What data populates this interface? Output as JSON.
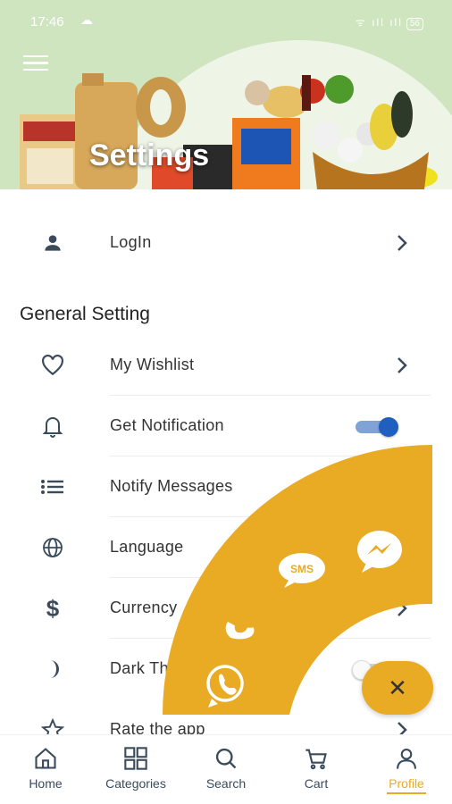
{
  "status_bar": {
    "time": "17:46",
    "signal": "ᯤ ıll ıll",
    "battery": "56"
  },
  "header": {
    "title": "Settings"
  },
  "login": {
    "label": "LogIn"
  },
  "general_setting": {
    "heading": "General Setting",
    "items": [
      {
        "label": "My Wishlist",
        "icon": "heart-icon",
        "control": "chevron"
      },
      {
        "label": "Get Notification",
        "icon": "bell-icon",
        "control": "toggle",
        "toggle_on": true
      },
      {
        "label": "Notify Messages",
        "icon": "list-icon",
        "control": "chevron"
      },
      {
        "label": "Language",
        "icon": "globe-icon",
        "control": "chevron"
      },
      {
        "label": "Currency",
        "icon": "dollar-icon",
        "control": "chevron"
      },
      {
        "label": "Dark Theme",
        "icon": "moon-icon",
        "control": "toggle",
        "toggle_on": false
      },
      {
        "label": "Rate the app",
        "icon": "star-icon",
        "control": "chevron"
      }
    ]
  },
  "share_menu": {
    "sms_label": "SMS",
    "close_symbol": "✕",
    "accent_color": "#e9aa24"
  },
  "bottom_nav": {
    "items": [
      {
        "label": "Home",
        "icon": "home-icon"
      },
      {
        "label": "Categories",
        "icon": "grid-icon"
      },
      {
        "label": "Search",
        "icon": "search-icon"
      },
      {
        "label": "Cart",
        "icon": "cart-icon"
      },
      {
        "label": "Profile",
        "icon": "profile-icon",
        "active": true
      }
    ]
  }
}
